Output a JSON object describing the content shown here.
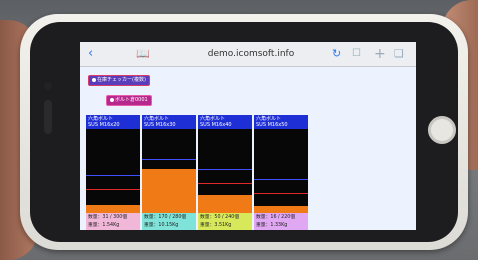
{
  "browser": {
    "url": "demo.icomsoft.info"
  },
  "chips": {
    "first": "在庫チェッカー(複数)",
    "second": "ボルト倉0001"
  },
  "bins": [
    {
      "name": "六角ボルト",
      "spec": "SUS M16x20",
      "count": "31 / 300個",
      "weight": "1.54Kg",
      "fill_level": 0.09
    },
    {
      "name": "六角ボルト",
      "spec": "SUS M16x30",
      "count": "170 / 280個",
      "weight": "10.15Kg",
      "fill_level": 0.52
    },
    {
      "name": "六角ボルト",
      "spec": "SUS M16x40",
      "count": "50 / 240個",
      "weight": "3.51Kg",
      "fill_level": 0.22
    },
    {
      "name": "六角ボルト",
      "spec": "SUS M16x50",
      "count": "16 / 220個",
      "weight": "1.33Kg",
      "fill_level": 0.08
    }
  ],
  "labels": {
    "count_prefix": "数量：",
    "weight_prefix": "重量："
  }
}
